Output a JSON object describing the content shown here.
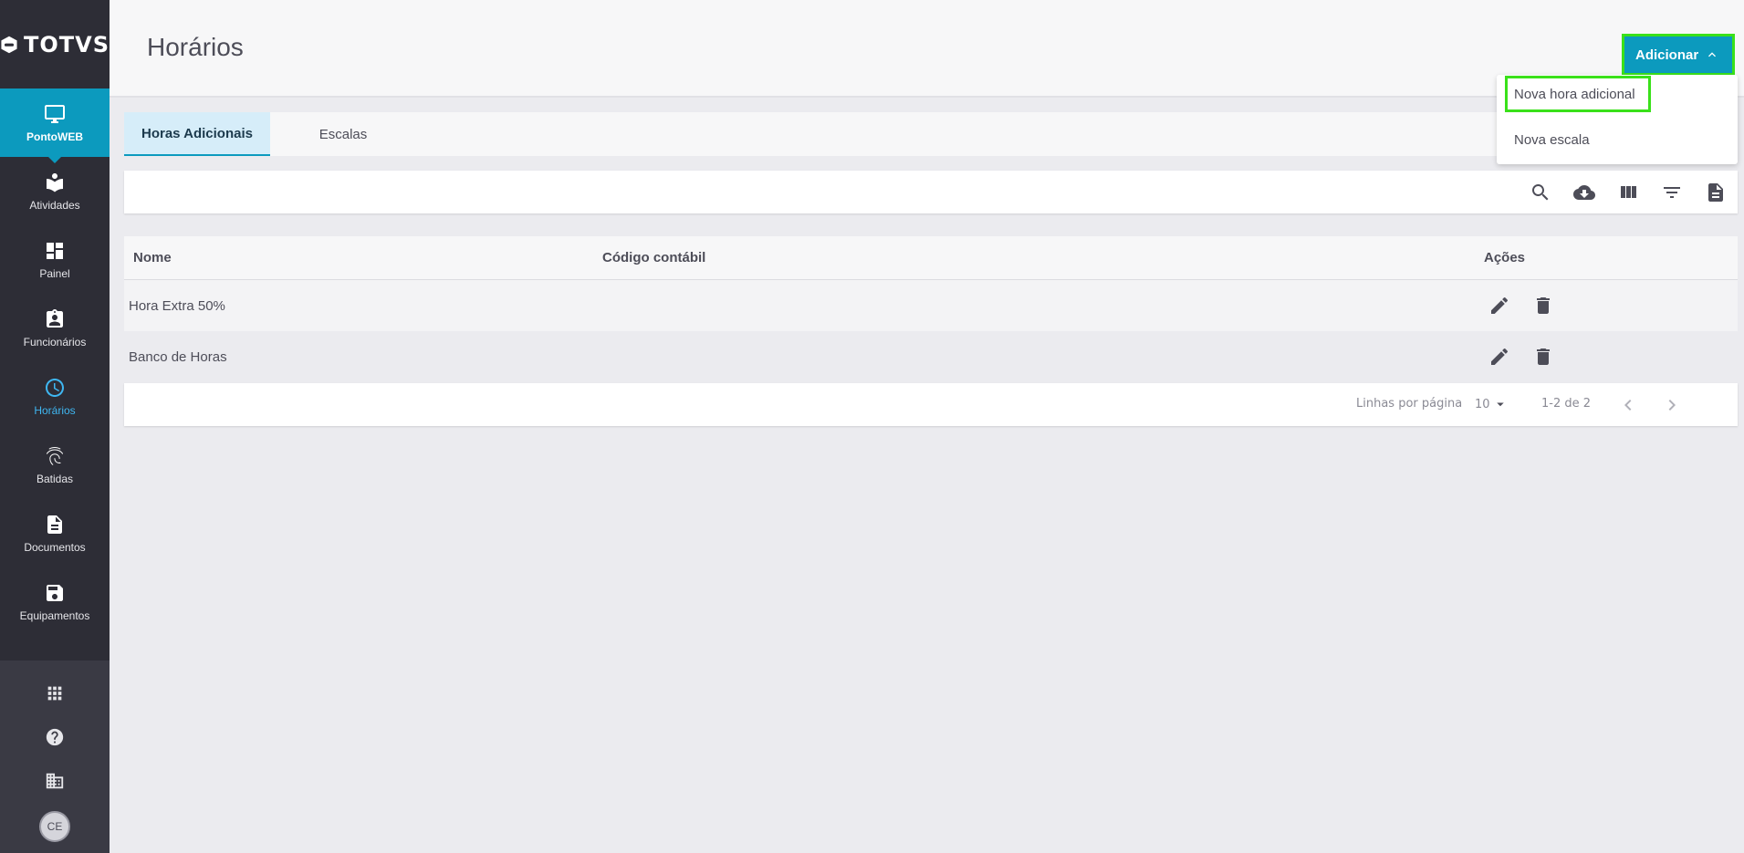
{
  "brand": {
    "name": "TOTVS",
    "accent": "#0c9abe",
    "highlight": "#3ae11a",
    "sidebar_bg": "#2d2d36"
  },
  "sidebar": {
    "items": [
      {
        "label": "PontoWEB",
        "icon": "monitor-icon",
        "state": "active"
      },
      {
        "label": "Atividades",
        "icon": "reading-icon"
      },
      {
        "label": "Painel",
        "icon": "dashboard-icon"
      },
      {
        "label": "Funcionários",
        "icon": "badge-icon"
      },
      {
        "label": "Horários",
        "icon": "clock-icon",
        "state": "current"
      },
      {
        "label": "Batidas",
        "icon": "fingerprint-icon"
      },
      {
        "label": "Documentos",
        "icon": "document-icon"
      },
      {
        "label": "Equipamentos",
        "icon": "device-icon"
      }
    ],
    "bottom": {
      "apps_icon": "apps-grid-icon",
      "help_icon": "help-icon",
      "company_icon": "building-icon",
      "avatar_initials": "CE"
    }
  },
  "header": {
    "title": "Horários",
    "add_button_label": "Adicionar"
  },
  "dropdown": {
    "items": [
      "Nova hora adicional",
      "Nova escala"
    ]
  },
  "tabs": [
    {
      "label": "Horas Adicionais",
      "active": true
    },
    {
      "label": "Escalas",
      "active": false
    }
  ],
  "toolbar": {
    "icons": [
      "search-icon",
      "cloud-download-icon",
      "columns-icon",
      "filter-icon",
      "file-icon"
    ]
  },
  "table": {
    "columns": [
      "Nome",
      "Código contábil",
      "Ações"
    ],
    "rows": [
      {
        "nome": "Hora Extra 50%",
        "codigo": ""
      },
      {
        "nome": "Banco de Horas",
        "codigo": ""
      }
    ]
  },
  "pagination": {
    "rows_per_page_label": "Linhas por página",
    "rows_per_page_value": "10",
    "range": "1-2 de 2"
  }
}
